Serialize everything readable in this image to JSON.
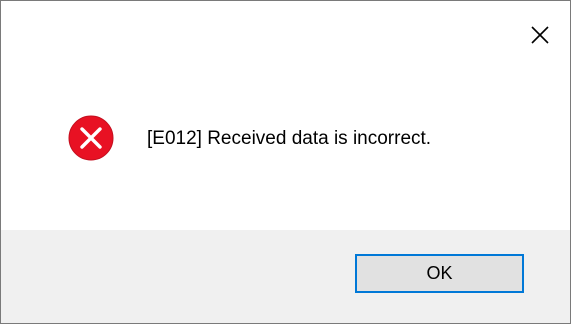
{
  "dialog": {
    "close_icon": "close-icon",
    "message": "[E012] Received data is incorrect.",
    "icon": "error-icon",
    "ok_label": "OK"
  },
  "colors": {
    "error_red": "#e81123",
    "button_focus_border": "#0078d7",
    "footer_bg": "#f0f0f0"
  }
}
